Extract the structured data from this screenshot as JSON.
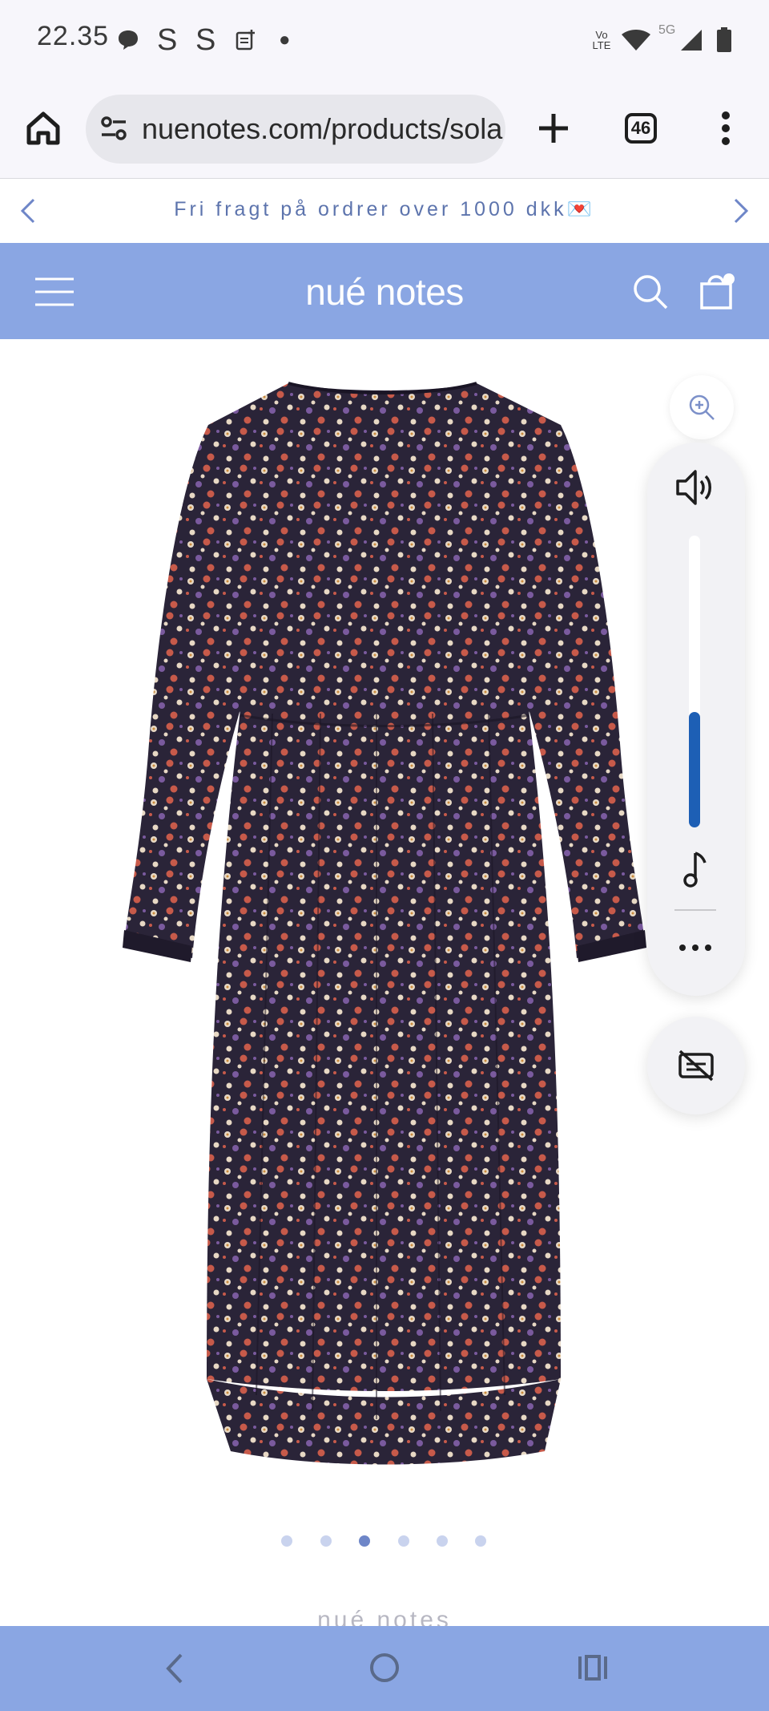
{
  "status_bar": {
    "time": "22.35",
    "network_label": "5G",
    "volte_label": "Vo LTE"
  },
  "browser": {
    "url": "nuenotes.com/products/sola",
    "tab_count": "46"
  },
  "announcement": {
    "text": "Fri fragt på ordrer over 1000 dkk💌"
  },
  "header": {
    "logo": "nué notes"
  },
  "gallery": {
    "dots_total": 6,
    "active_index": 2
  },
  "footer": {
    "brand_text": "nué notes"
  },
  "volume": {
    "level": 0.4
  },
  "colors": {
    "brand_blue": "#8aa6e3",
    "announcement_text": "#5d74ad",
    "volume_fill": "#1d5fb5",
    "dress_base": "#2a2438"
  },
  "icons": [
    "home-icon",
    "site-settings-icon",
    "plus-icon",
    "tabs-icon",
    "more-vert-icon",
    "chevron-left-icon",
    "chevron-right-icon",
    "menu-icon",
    "search-icon",
    "cart-icon",
    "zoom-in-icon",
    "speaker-icon",
    "music-note-icon",
    "more-horiz-icon",
    "captions-off-icon",
    "nav-back-icon",
    "nav-home-icon",
    "nav-recents-icon"
  ]
}
